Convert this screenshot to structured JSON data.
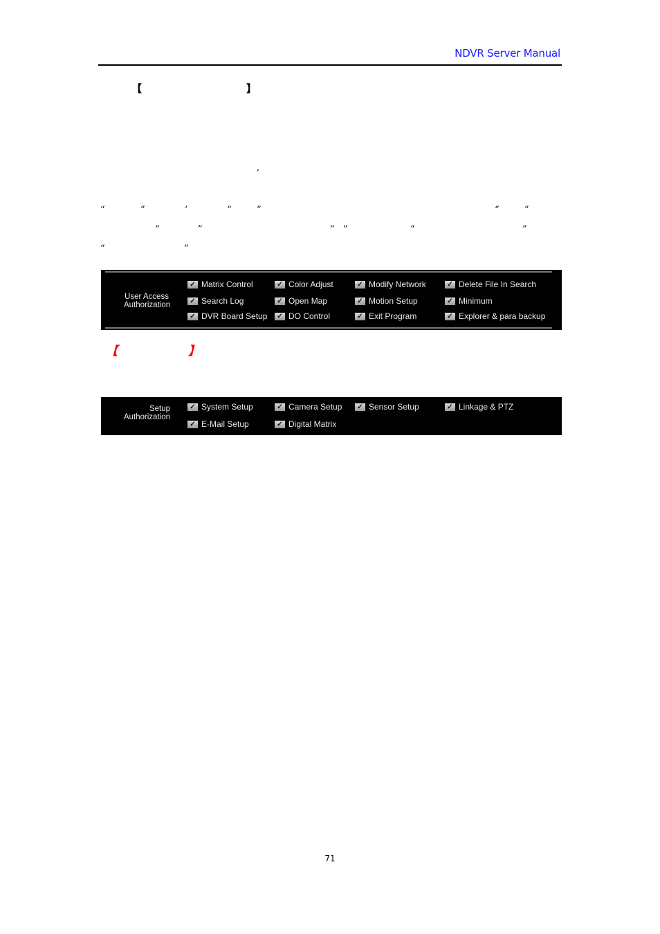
{
  "header": {
    "title": "NDVR Server Manual"
  },
  "section": {
    "bracket_open": "【",
    "bracket_close": "】",
    "comma": ","
  },
  "quotes": {
    "open": "“",
    "close": "”",
    "apostrophe": "’"
  },
  "user_access_panel": {
    "label_line1": "User Access",
    "label_line2": "Authorization",
    "options": [
      {
        "label": "Matrix Control",
        "checked": true
      },
      {
        "label": "Color Adjust",
        "checked": true
      },
      {
        "label": "Modify Network",
        "checked": true
      },
      {
        "label": "Delete File In Search",
        "checked": true
      },
      {
        "label": "Search Log",
        "checked": true
      },
      {
        "label": "Open Map",
        "checked": true
      },
      {
        "label": "Motion Setup",
        "checked": true
      },
      {
        "label": "Minimum",
        "checked": true
      },
      {
        "label": "DVR Board Setup",
        "checked": true
      },
      {
        "label": "DO Control",
        "checked": true
      },
      {
        "label": "Exit Program",
        "checked": true
      },
      {
        "label": "Explorer & para backup",
        "checked": true
      }
    ]
  },
  "red_heading": {
    "bracket_open": "【",
    "bracket_close": "】",
    "color": "#ff0000"
  },
  "setup_panel": {
    "label_line1": "Setup",
    "label_line2": "Authorization",
    "options": [
      {
        "label": "System Setup",
        "checked": true
      },
      {
        "label": "Camera Setup",
        "checked": true
      },
      {
        "label": "Sensor Setup",
        "checked": true
      },
      {
        "label": "Linkage & PTZ",
        "checked": true
      },
      {
        "label": "E-Mail Setup",
        "checked": true
      },
      {
        "label": "Digital Matrix",
        "checked": true
      }
    ]
  },
  "checkbox_glyph": "✓",
  "footer": {
    "page_number": "71"
  }
}
